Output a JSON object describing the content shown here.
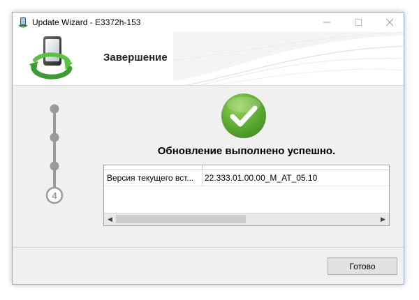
{
  "window": {
    "title": "Update Wizard - E3372h-153",
    "controls": [
      "minimize",
      "maximize",
      "close"
    ]
  },
  "header": {
    "heading": "Завершение"
  },
  "stepper": {
    "total_steps": 4,
    "current_step": 4,
    "current_label": "4"
  },
  "result": {
    "message": "Обновление выполнено успешно."
  },
  "details_table": {
    "rows": [
      {
        "label": "Версия текущего вст...",
        "value": "22.333.01.00.00_M_AT_05.10"
      }
    ]
  },
  "footer": {
    "done_label": "Готово"
  },
  "colors": {
    "success_green": "#5aa832",
    "stepper_gray": "#9a9a9a",
    "logo_green": "#3f9c35"
  }
}
